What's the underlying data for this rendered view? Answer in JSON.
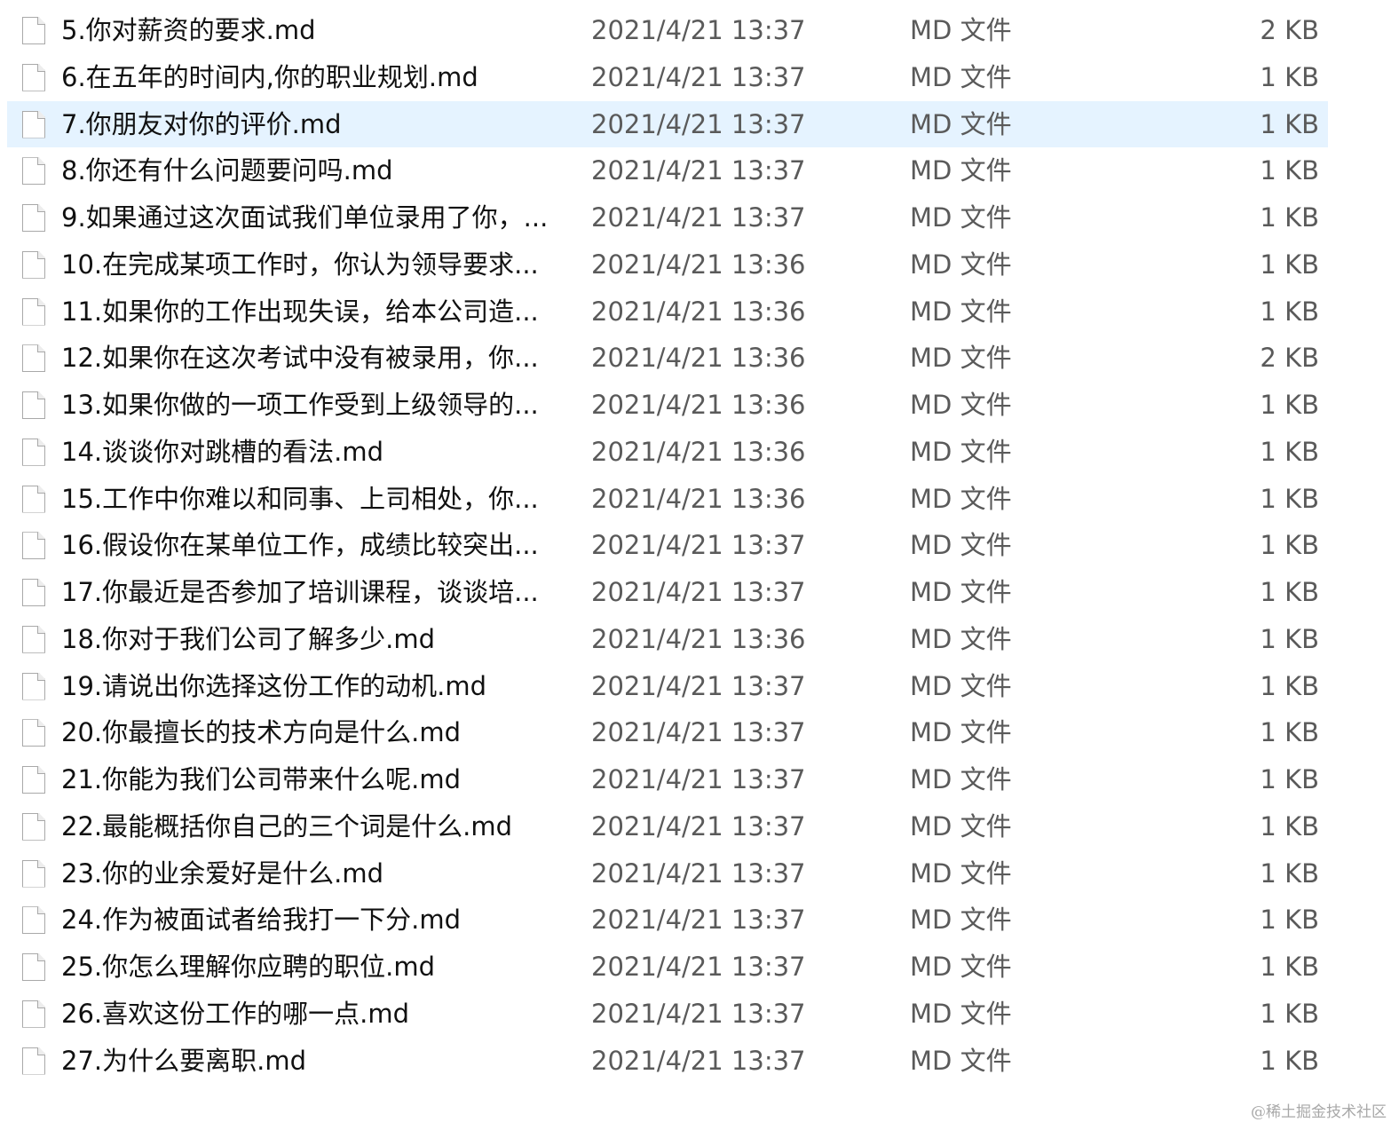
{
  "files": [
    {
      "name": "5.你对薪资的要求.md",
      "modified": "2021/4/21 13:37",
      "type": "MD 文件",
      "size": "2 KB",
      "selected": false
    },
    {
      "name": "6.在五年的时间内,你的职业规划.md",
      "modified": "2021/4/21 13:37",
      "type": "MD 文件",
      "size": "1 KB",
      "selected": false
    },
    {
      "name": "7.你朋友对你的评价.md",
      "modified": "2021/4/21 13:37",
      "type": "MD 文件",
      "size": "1 KB",
      "selected": true
    },
    {
      "name": "8.你还有什么问题要问吗.md",
      "modified": "2021/4/21 13:37",
      "type": "MD 文件",
      "size": "1 KB",
      "selected": false
    },
    {
      "name": "9.如果通过这次面试我们单位录用了你，...",
      "modified": "2021/4/21 13:37",
      "type": "MD 文件",
      "size": "1 KB",
      "selected": false
    },
    {
      "name": "10.在完成某项工作时，你认为领导要求...",
      "modified": "2021/4/21 13:36",
      "type": "MD 文件",
      "size": "1 KB",
      "selected": false
    },
    {
      "name": "11.如果你的工作出现失误，给本公司造...",
      "modified": "2021/4/21 13:36",
      "type": "MD 文件",
      "size": "1 KB",
      "selected": false
    },
    {
      "name": "12.如果你在这次考试中没有被录用，你...",
      "modified": "2021/4/21 13:36",
      "type": "MD 文件",
      "size": "2 KB",
      "selected": false
    },
    {
      "name": "13.如果你做的一项工作受到上级领导的...",
      "modified": "2021/4/21 13:36",
      "type": "MD 文件",
      "size": "1 KB",
      "selected": false
    },
    {
      "name": "14.谈谈你对跳槽的看法.md",
      "modified": "2021/4/21 13:36",
      "type": "MD 文件",
      "size": "1 KB",
      "selected": false
    },
    {
      "name": "15.工作中你难以和同事、上司相处，你...",
      "modified": "2021/4/21 13:36",
      "type": "MD 文件",
      "size": "1 KB",
      "selected": false
    },
    {
      "name": "16.假设你在某单位工作，成绩比较突出...",
      "modified": "2021/4/21 13:37",
      "type": "MD 文件",
      "size": "1 KB",
      "selected": false
    },
    {
      "name": "17.你最近是否参加了培训课程，谈谈培...",
      "modified": "2021/4/21 13:37",
      "type": "MD 文件",
      "size": "1 KB",
      "selected": false
    },
    {
      "name": "18.你对于我们公司了解多少.md",
      "modified": "2021/4/21 13:36",
      "type": "MD 文件",
      "size": "1 KB",
      "selected": false
    },
    {
      "name": "19.请说出你选择这份工作的动机.md",
      "modified": "2021/4/21 13:37",
      "type": "MD 文件",
      "size": "1 KB",
      "selected": false
    },
    {
      "name": "20.你最擅长的技术方向是什么.md",
      "modified": "2021/4/21 13:37",
      "type": "MD 文件",
      "size": "1 KB",
      "selected": false
    },
    {
      "name": "21.你能为我们公司带来什么呢.md",
      "modified": "2021/4/21 13:37",
      "type": "MD 文件",
      "size": "1 KB",
      "selected": false
    },
    {
      "name": "22.最能概括你自己的三个词是什么.md",
      "modified": "2021/4/21 13:37",
      "type": "MD 文件",
      "size": "1 KB",
      "selected": false
    },
    {
      "name": "23.你的业余爱好是什么.md",
      "modified": "2021/4/21 13:37",
      "type": "MD 文件",
      "size": "1 KB",
      "selected": false
    },
    {
      "name": "24.作为被面试者给我打一下分.md",
      "modified": "2021/4/21 13:37",
      "type": "MD 文件",
      "size": "1 KB",
      "selected": false
    },
    {
      "name": "25.你怎么理解你应聘的职位.md",
      "modified": "2021/4/21 13:37",
      "type": "MD 文件",
      "size": "1 KB",
      "selected": false
    },
    {
      "name": "26.喜欢这份工作的哪一点.md",
      "modified": "2021/4/21 13:37",
      "type": "MD 文件",
      "size": "1 KB",
      "selected": false
    },
    {
      "name": "27.为什么要离职.md",
      "modified": "2021/4/21 13:37",
      "type": "MD 文件",
      "size": "1 KB",
      "selected": false
    }
  ],
  "icons": {
    "file": "document-icon"
  },
  "colors": {
    "selected_row": "#e5f3ff",
    "name_text": "#111111",
    "detail_text": "#5a5a5a",
    "watermark": "#a8a8a8"
  },
  "watermark": "@稀土掘金技术社区"
}
